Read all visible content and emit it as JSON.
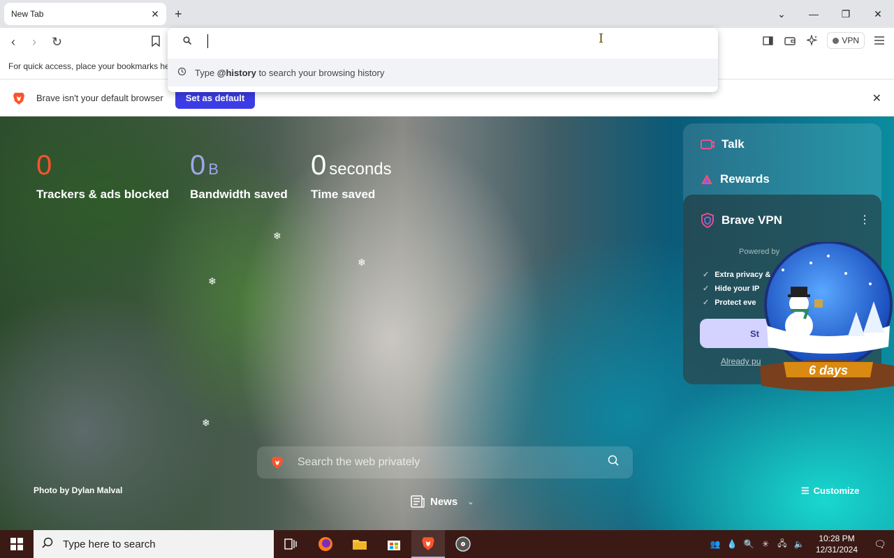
{
  "browser": {
    "tab_title": "New Tab",
    "tab_close": "✕",
    "new_tab_symbol": "+",
    "window_controls": [
      "⌄",
      "—",
      "❐",
      "✕"
    ],
    "toolbar": {
      "back": "‹",
      "forward": "›",
      "reload": "↻",
      "vpn_label": "VPN"
    },
    "bookmarks_hint": "For quick access, place your bookmarks here on the bookmarks bar.",
    "omnibox": {
      "suggestion_prefix": "Type ",
      "suggestion_keyword": "@history",
      "suggestion_suffix": " to search your browsing history"
    },
    "infobar": {
      "message": "Brave isn't your default browser",
      "button": "Set as default"
    }
  },
  "ntp": {
    "stats": [
      {
        "value": "0",
        "unit": "",
        "label": "Trackers & ads blocked",
        "color": "#fb542b"
      },
      {
        "value": "0",
        "unit": "B",
        "label": "Bandwidth saved",
        "color": "#a0a5eb"
      },
      {
        "value": "0",
        "unit": "seconds",
        "label": "Time saved",
        "color": "#ffffff"
      }
    ],
    "search_placeholder": "Search the web privately",
    "photo_credit": "Photo by Dylan Malval",
    "news_label": "News",
    "customize_label": "Customize",
    "widgets": {
      "talk": "Talk",
      "rewards": "Rewards",
      "vpn": {
        "title": "Brave VPN",
        "powered_by": "Powered by",
        "features": [
          "Extra privacy &",
          "Hide your IP",
          "Protect eve"
        ],
        "start_button": "St",
        "already": "Already pu"
      }
    },
    "snow_globe_text": "6 days"
  },
  "taskbar": {
    "search_placeholder": "Type here to search",
    "time": "10:28 PM",
    "date": "12/31/2024"
  },
  "colors": {
    "accent": "#3c3ce6",
    "taskbar": "#3b1a16"
  }
}
